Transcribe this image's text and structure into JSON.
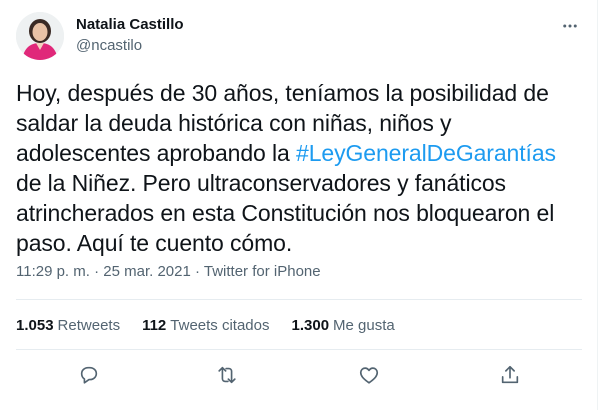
{
  "tweet": {
    "author": {
      "name": "Natalia Castillo",
      "handle": "@ncastilo"
    },
    "text_before": "Hoy, después de 30 años, teníamos la posibilidad de saldar la deuda histórica con niñas, niños y adolescentes aprobando la ",
    "hashtag": "#LeyGeneralDeGarantías",
    "text_after": " de la Niñez. Pero ultraconservadores y fanáticos atrincherados en esta Constitución nos bloquearon el paso. Aquí te cuento cómo.",
    "meta": "11:29 p. m. · 25 mar. 2021 · Twitter for iPhone",
    "stats": {
      "retweets_count": "1.053",
      "retweets_label": "Retweets",
      "quotes_count": "112",
      "quotes_label": "Tweets citados",
      "likes_count": "1.300",
      "likes_label": "Me gusta"
    }
  },
  "colors": {
    "link": "#1d9bf0",
    "secondary_text": "#536471",
    "primary_text": "#0f1419",
    "icon": "#536471",
    "avatar_outfit": "#e0287a"
  },
  "icons": {
    "more": "more-icon",
    "reply": "reply-icon",
    "retweet": "retweet-icon",
    "like": "like-icon",
    "share": "share-icon"
  }
}
